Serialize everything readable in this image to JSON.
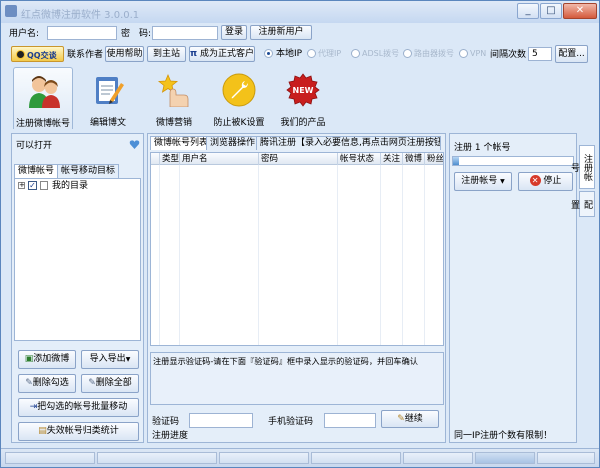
{
  "window": {
    "title": "红点微博注册软件 3.0.0.1",
    "min": "_",
    "max": "□",
    "close": "✕"
  },
  "login": {
    "user_label": "用户名:",
    "pass_label": "密　码:",
    "login_button": "登录",
    "register_button": "注册新用户"
  },
  "toolbar": {
    "qq_button": "QQ交谈",
    "contact_author": "联系作者",
    "help": "使用帮助",
    "main_site": "到主站",
    "become_customer": "成为正式客户",
    "ip_options": [
      "本地IP",
      "代理IP",
      "ADSL拨号",
      "路由器拨号",
      "VPN"
    ],
    "ip_selected": 0,
    "interval_label": "间隔次数",
    "interval_value": "5",
    "config_button": "配置..."
  },
  "ribbon": [
    {
      "label": "注册微博帐号",
      "icon": "people-icon"
    },
    {
      "label": "编辑博文",
      "icon": "notepad-pencil-icon"
    },
    {
      "label": "微博营销",
      "icon": "star-hand-icon"
    },
    {
      "label": "防止被K设置",
      "icon": "wrench-icon"
    },
    {
      "label": "我们的产品",
      "icon": "new-badge-icon"
    }
  ],
  "left": {
    "header": "可以打开",
    "tabs": [
      "微博帐号",
      "帐号移动目标"
    ],
    "tree_root": "我的目录",
    "buttons": {
      "add": "添加微博",
      "import_export": "导入导出",
      "delete_checked": "删除勾选",
      "delete_all": "删除全部",
      "batch_move": "把勾选的帐号批量移动",
      "stats": "失效帐号归类统计"
    }
  },
  "middle": {
    "tabs": [
      "微博帐号列表",
      "浏览器操作",
      "腾讯注册【录入必要信息,再点击网页注册按钮】"
    ],
    "columns": [
      "类型",
      "用户名",
      "密码",
      "帐号状态",
      "关注",
      "微博",
      "粉丝"
    ],
    "captcha_tip": "注册显示验证码-请在下面『验证码』框中录入显示的验证码，并回车确认",
    "captcha_label": "验证码",
    "phone_captcha_label": "手机验证码",
    "continue_button": "继续",
    "progress_label": "注册进度"
  },
  "right": {
    "count_label": "注册 1 个帐号",
    "register_button": "注册帐号",
    "stop_button": "停止",
    "footer_note": "同一IP注册个数有限制！",
    "progress": 0.05
  },
  "vtabs": [
    "注册帐号",
    "配置"
  ]
}
